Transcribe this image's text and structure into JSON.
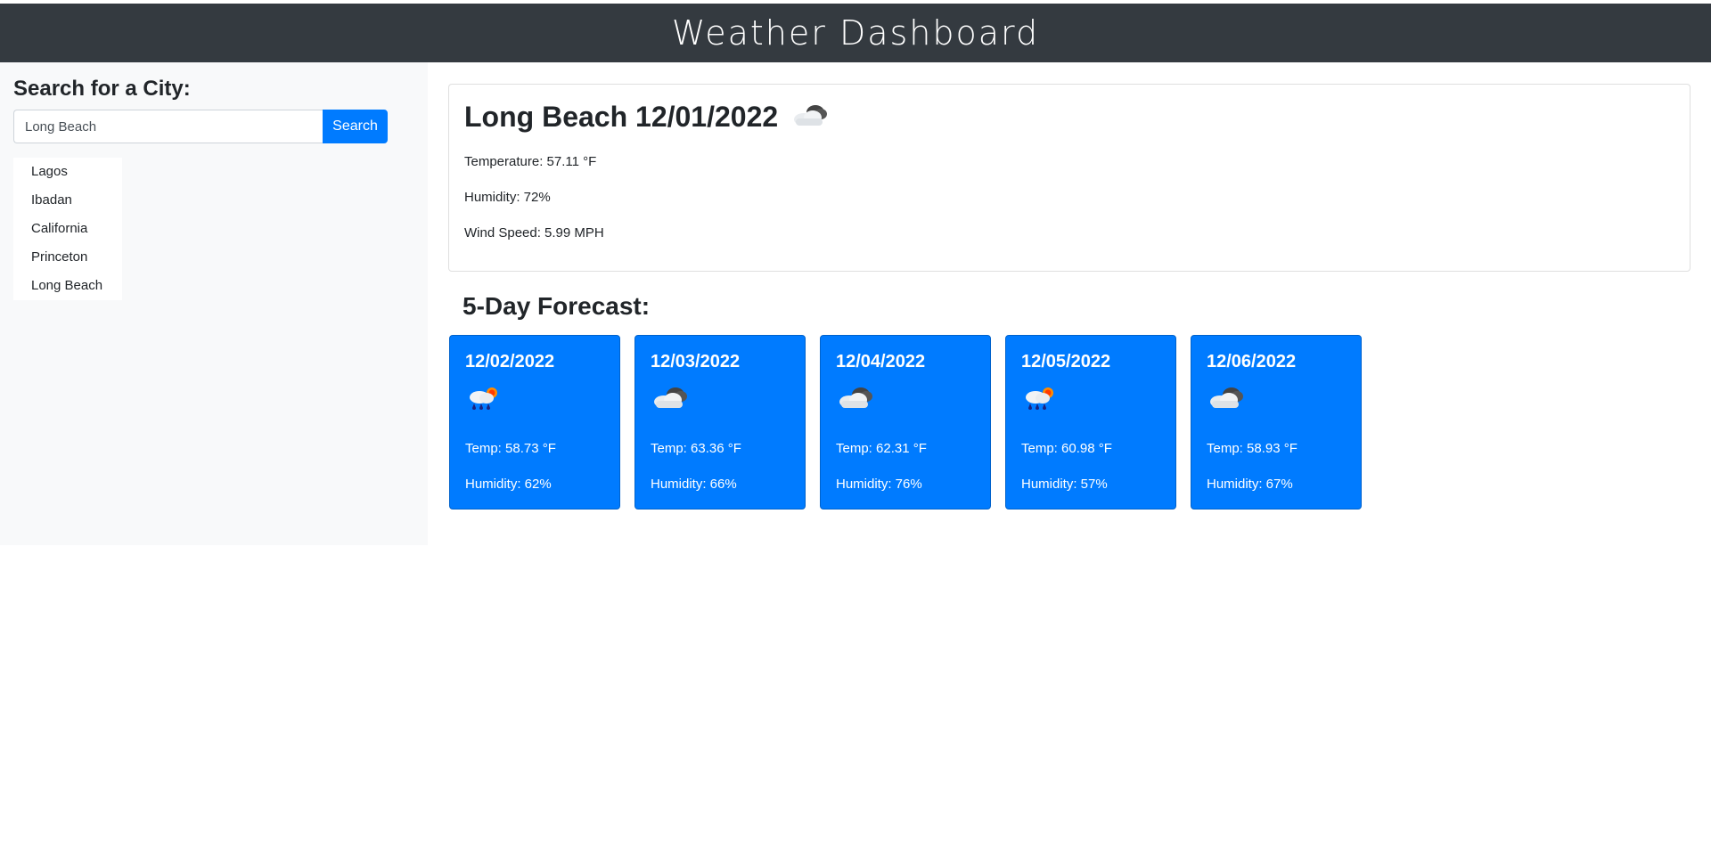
{
  "header": {
    "title": "Weather Dashboard"
  },
  "sidebar": {
    "heading": "Search for a City:",
    "search": {
      "value": "Long Beach",
      "button_label": "Search"
    },
    "history": [
      "Lagos",
      "Ibadan",
      "California",
      "Princeton",
      "Long Beach"
    ]
  },
  "current": {
    "title": "Long Beach 12/01/2022",
    "icon": "cloudy-icon",
    "temperature": "Temperature: 57.11 °F",
    "humidity": "Humidity: 72%",
    "wind": "Wind Speed: 5.99 MPH"
  },
  "forecast": {
    "heading": "5-Day Forecast:",
    "days": [
      {
        "date": "12/02/2022",
        "icon": "rain-sun-icon",
        "temp": "Temp: 58.73 °F",
        "humidity": "Humidity: 62%"
      },
      {
        "date": "12/03/2022",
        "icon": "cloudy-icon",
        "temp": "Temp: 63.36 °F",
        "humidity": "Humidity: 66%"
      },
      {
        "date": "12/04/2022",
        "icon": "cloudy-icon",
        "temp": "Temp: 62.31 °F",
        "humidity": "Humidity: 76%"
      },
      {
        "date": "12/05/2022",
        "icon": "rain-sun-icon",
        "temp": "Temp: 60.98 °F",
        "humidity": "Humidity: 57%"
      },
      {
        "date": "12/06/2022",
        "icon": "cloudy-icon",
        "temp": "Temp: 58.93 °F",
        "humidity": "Humidity: 67%"
      }
    ]
  },
  "colors": {
    "header_bg": "#343a40",
    "accent": "#007bff",
    "sidebar_bg": "#f8f9fa"
  }
}
